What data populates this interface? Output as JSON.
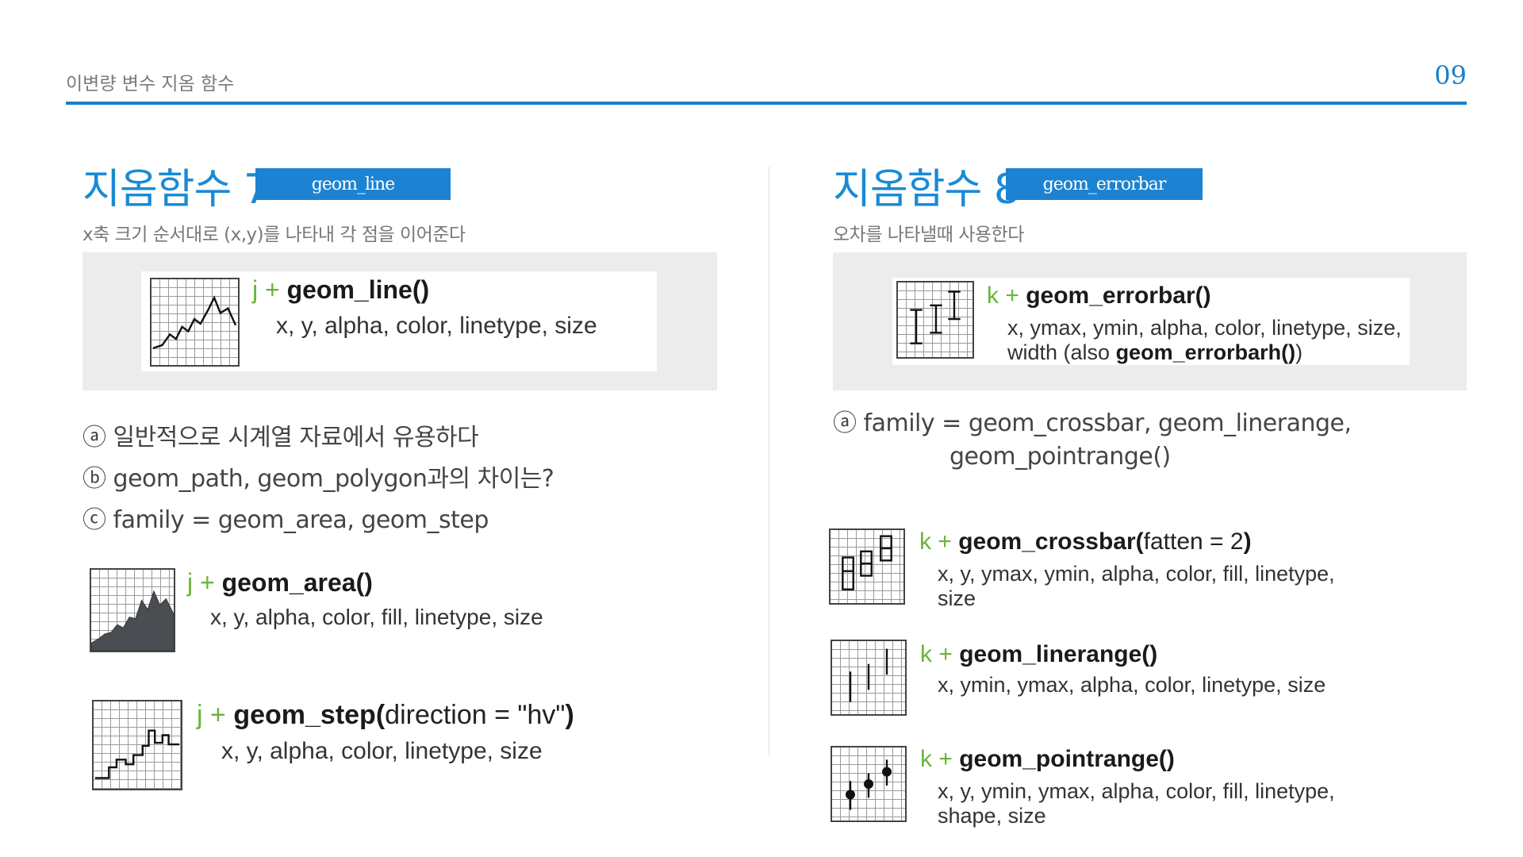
{
  "header": {
    "title": "이변량 변수 지옴 함수",
    "page_number": "09"
  },
  "left": {
    "title": "지옴함수 7",
    "badge": "geom_line",
    "description": "x축 크기 순서대로 (x,y)를 나타내 각 점을 이어준다",
    "main_func": {
      "var": "j",
      "plus": "+",
      "name": "geom_line()",
      "args": "x, y, alpha, color, linetype, size",
      "icon": "line-chart-icon"
    },
    "notes": [
      "ⓐ 일반적으로 시계열 자료에서 유용하다",
      "ⓑ geom_path, geom_polygon과의 차이는?",
      "ⓒ family = geom_area, geom_step"
    ],
    "related": [
      {
        "var": "j",
        "plus": "+",
        "name": "geom_area()",
        "arg": "",
        "close": "",
        "args": "x, y, alpha, color, fill, linetype, size",
        "icon": "area-chart-icon"
      },
      {
        "var": "j",
        "plus": "+",
        "name": "geom_step(",
        "arg": "direction = \"hv\"",
        "close": ")",
        "args": "x, y, alpha, color, linetype, size",
        "icon": "step-chart-icon"
      }
    ]
  },
  "right": {
    "title": "지옴함수 8",
    "badge": "geom_errorbar",
    "description": "오차를 나타낼때 사용한다",
    "main_func": {
      "var": "k",
      "plus": "+",
      "name": "geom_errorbar()",
      "args_line1": "x, ymax, ymin, alpha, color, linetype, size,",
      "args_line2_prefix": "width (also ",
      "args_line2_bold": "geom_errorbarh()",
      "args_line2_suffix": ")",
      "icon": "errorbar-icon"
    },
    "notes": [
      "ⓐ family = geom_crossbar, geom_linerange,",
      "geom_pointrange()"
    ],
    "related": [
      {
        "var": "k",
        "plus": "+",
        "name": "geom_crossbar(",
        "arg": "fatten = 2",
        "close": ")",
        "args_line1": "x, y, ymax, ymin, alpha, color, fill, linetype,",
        "args_line2": "size",
        "icon": "crossbar-icon"
      },
      {
        "var": "k",
        "plus": "+",
        "name": "geom_linerange()",
        "arg": "",
        "close": "",
        "args_line1": "x, ymin, ymax, alpha, color, linetype, size",
        "args_line2": "",
        "icon": "linerange-icon"
      },
      {
        "var": "k",
        "plus": "+",
        "name": "geom_pointrange()",
        "arg": "",
        "close": "",
        "args_line1": "x, y, ymin, ymax, alpha, color, fill, linetype,",
        "args_line2": "shape, size",
        "icon": "pointrange-icon"
      }
    ]
  },
  "colors": {
    "accent": "#1a7fc8",
    "badge": "#1c82d1",
    "var_green": "#6ab43b",
    "panel_gray": "#ececec"
  }
}
